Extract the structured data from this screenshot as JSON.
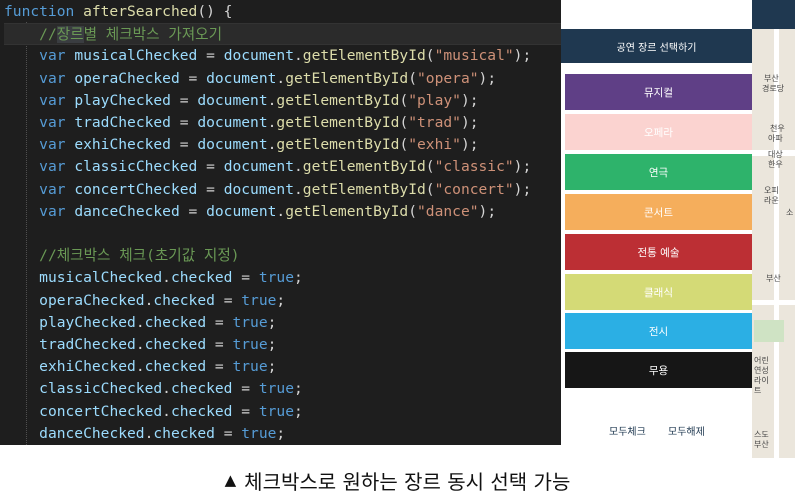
{
  "editor": {
    "lines": [
      [
        {
          "c": "tk-kw",
          "t": "function "
        },
        {
          "c": "tk-fn",
          "t": "afterSearched"
        },
        {
          "c": "tk-pl",
          "t": "() {"
        }
      ],
      [
        {
          "c": "tk-pl",
          "t": "    "
        },
        {
          "c": "tk-cm",
          "t": "//"
        },
        {
          "c": "tk-cm tk-sel",
          "t": "장르"
        },
        {
          "c": "tk-cm",
          "t": "별 체크박스 가져오기"
        }
      ],
      [
        {
          "c": "tk-pl",
          "t": "    "
        },
        {
          "c": "tk-kw",
          "t": "var "
        },
        {
          "c": "tk-var",
          "t": "musicalChecked"
        },
        {
          "c": "tk-pl",
          "t": " = "
        },
        {
          "c": "tk-var",
          "t": "document"
        },
        {
          "c": "tk-pl",
          "t": "."
        },
        {
          "c": "tk-fn",
          "t": "getElementById"
        },
        {
          "c": "tk-pl",
          "t": "("
        },
        {
          "c": "tk-str",
          "t": "\"musical\""
        },
        {
          "c": "tk-pl",
          "t": ");"
        }
      ],
      [
        {
          "c": "tk-pl",
          "t": "    "
        },
        {
          "c": "tk-kw",
          "t": "var "
        },
        {
          "c": "tk-var",
          "t": "operaChecked"
        },
        {
          "c": "tk-pl",
          "t": " = "
        },
        {
          "c": "tk-var",
          "t": "document"
        },
        {
          "c": "tk-pl",
          "t": "."
        },
        {
          "c": "tk-fn",
          "t": "getElementById"
        },
        {
          "c": "tk-pl",
          "t": "("
        },
        {
          "c": "tk-str",
          "t": "\"opera\""
        },
        {
          "c": "tk-pl",
          "t": ");"
        }
      ],
      [
        {
          "c": "tk-pl",
          "t": "    "
        },
        {
          "c": "tk-kw",
          "t": "var "
        },
        {
          "c": "tk-var",
          "t": "playChecked"
        },
        {
          "c": "tk-pl",
          "t": " = "
        },
        {
          "c": "tk-var",
          "t": "document"
        },
        {
          "c": "tk-pl",
          "t": "."
        },
        {
          "c": "tk-fn",
          "t": "getElementById"
        },
        {
          "c": "tk-pl",
          "t": "("
        },
        {
          "c": "tk-str",
          "t": "\"play\""
        },
        {
          "c": "tk-pl",
          "t": ");"
        }
      ],
      [
        {
          "c": "tk-pl",
          "t": "    "
        },
        {
          "c": "tk-kw",
          "t": "var "
        },
        {
          "c": "tk-var",
          "t": "tradChecked"
        },
        {
          "c": "tk-pl",
          "t": " = "
        },
        {
          "c": "tk-var",
          "t": "document"
        },
        {
          "c": "tk-pl",
          "t": "."
        },
        {
          "c": "tk-fn",
          "t": "getElementById"
        },
        {
          "c": "tk-pl",
          "t": "("
        },
        {
          "c": "tk-str",
          "t": "\"trad\""
        },
        {
          "c": "tk-pl",
          "t": ");"
        }
      ],
      [
        {
          "c": "tk-pl",
          "t": "    "
        },
        {
          "c": "tk-kw",
          "t": "var "
        },
        {
          "c": "tk-var",
          "t": "exhiChecked"
        },
        {
          "c": "tk-pl",
          "t": " = "
        },
        {
          "c": "tk-var",
          "t": "document"
        },
        {
          "c": "tk-pl",
          "t": "."
        },
        {
          "c": "tk-fn",
          "t": "getElementById"
        },
        {
          "c": "tk-pl",
          "t": "("
        },
        {
          "c": "tk-str",
          "t": "\"exhi\""
        },
        {
          "c": "tk-pl",
          "t": ");"
        }
      ],
      [
        {
          "c": "tk-pl",
          "t": "    "
        },
        {
          "c": "tk-kw",
          "t": "var "
        },
        {
          "c": "tk-var",
          "t": "classicChecked"
        },
        {
          "c": "tk-pl",
          "t": " = "
        },
        {
          "c": "tk-var",
          "t": "document"
        },
        {
          "c": "tk-pl",
          "t": "."
        },
        {
          "c": "tk-fn",
          "t": "getElementById"
        },
        {
          "c": "tk-pl",
          "t": "("
        },
        {
          "c": "tk-str",
          "t": "\"classic\""
        },
        {
          "c": "tk-pl",
          "t": ");"
        }
      ],
      [
        {
          "c": "tk-pl",
          "t": "    "
        },
        {
          "c": "tk-kw",
          "t": "var "
        },
        {
          "c": "tk-var",
          "t": "concertChecked"
        },
        {
          "c": "tk-pl",
          "t": " = "
        },
        {
          "c": "tk-var",
          "t": "document"
        },
        {
          "c": "tk-pl",
          "t": "."
        },
        {
          "c": "tk-fn",
          "t": "getElementById"
        },
        {
          "c": "tk-pl",
          "t": "("
        },
        {
          "c": "tk-str",
          "t": "\"concert\""
        },
        {
          "c": "tk-pl",
          "t": ");"
        }
      ],
      [
        {
          "c": "tk-pl",
          "t": "    "
        },
        {
          "c": "tk-kw",
          "t": "var "
        },
        {
          "c": "tk-var",
          "t": "danceChecked"
        },
        {
          "c": "tk-pl",
          "t": " = "
        },
        {
          "c": "tk-var",
          "t": "document"
        },
        {
          "c": "tk-pl",
          "t": "."
        },
        {
          "c": "tk-fn",
          "t": "getElementById"
        },
        {
          "c": "tk-pl",
          "t": "("
        },
        {
          "c": "tk-str",
          "t": "\"dance\""
        },
        {
          "c": "tk-pl",
          "t": ");"
        }
      ],
      [],
      [
        {
          "c": "tk-pl",
          "t": "    "
        },
        {
          "c": "tk-cm",
          "t": "//체크박스 체크(초기값 지정)"
        }
      ],
      [
        {
          "c": "tk-pl",
          "t": "    "
        },
        {
          "c": "tk-var",
          "t": "musicalChecked"
        },
        {
          "c": "tk-pl",
          "t": "."
        },
        {
          "c": "tk-var",
          "t": "checked"
        },
        {
          "c": "tk-pl",
          "t": " = "
        },
        {
          "c": "tk-bool",
          "t": "true"
        },
        {
          "c": "tk-pl",
          "t": ";"
        }
      ],
      [
        {
          "c": "tk-pl",
          "t": "    "
        },
        {
          "c": "tk-var",
          "t": "operaChecked"
        },
        {
          "c": "tk-pl",
          "t": "."
        },
        {
          "c": "tk-var",
          "t": "checked"
        },
        {
          "c": "tk-pl",
          "t": " = "
        },
        {
          "c": "tk-bool",
          "t": "true"
        },
        {
          "c": "tk-pl",
          "t": ";"
        }
      ],
      [
        {
          "c": "tk-pl",
          "t": "    "
        },
        {
          "c": "tk-var",
          "t": "playChecked"
        },
        {
          "c": "tk-pl",
          "t": "."
        },
        {
          "c": "tk-var",
          "t": "checked"
        },
        {
          "c": "tk-pl",
          "t": " = "
        },
        {
          "c": "tk-bool",
          "t": "true"
        },
        {
          "c": "tk-pl",
          "t": ";"
        }
      ],
      [
        {
          "c": "tk-pl",
          "t": "    "
        },
        {
          "c": "tk-var",
          "t": "tradChecked"
        },
        {
          "c": "tk-pl",
          "t": "."
        },
        {
          "c": "tk-var",
          "t": "checked"
        },
        {
          "c": "tk-pl",
          "t": " = "
        },
        {
          "c": "tk-bool",
          "t": "true"
        },
        {
          "c": "tk-pl",
          "t": ";"
        }
      ],
      [
        {
          "c": "tk-pl",
          "t": "    "
        },
        {
          "c": "tk-var",
          "t": "exhiChecked"
        },
        {
          "c": "tk-pl",
          "t": "."
        },
        {
          "c": "tk-var",
          "t": "checked"
        },
        {
          "c": "tk-pl",
          "t": " = "
        },
        {
          "c": "tk-bool",
          "t": "true"
        },
        {
          "c": "tk-pl",
          "t": ";"
        }
      ],
      [
        {
          "c": "tk-pl",
          "t": "    "
        },
        {
          "c": "tk-var",
          "t": "classicChecked"
        },
        {
          "c": "tk-pl",
          "t": "."
        },
        {
          "c": "tk-var",
          "t": "checked"
        },
        {
          "c": "tk-pl",
          "t": " = "
        },
        {
          "c": "tk-bool",
          "t": "true"
        },
        {
          "c": "tk-pl",
          "t": ";"
        }
      ],
      [
        {
          "c": "tk-pl",
          "t": "    "
        },
        {
          "c": "tk-var",
          "t": "concertChecked"
        },
        {
          "c": "tk-pl",
          "t": "."
        },
        {
          "c": "tk-var",
          "t": "checked"
        },
        {
          "c": "tk-pl",
          "t": " = "
        },
        {
          "c": "tk-bool",
          "t": "true"
        },
        {
          "c": "tk-pl",
          "t": ";"
        }
      ],
      [
        {
          "c": "tk-pl",
          "t": "    "
        },
        {
          "c": "tk-var",
          "t": "danceChecked"
        },
        {
          "c": "tk-pl",
          "t": "."
        },
        {
          "c": "tk-var",
          "t": "checked"
        },
        {
          "c": "tk-pl",
          "t": " = "
        },
        {
          "c": "tk-bool",
          "t": "true"
        },
        {
          "c": "tk-pl",
          "t": ";"
        }
      ]
    ]
  },
  "panel": {
    "header": "공연 장르 선택하기",
    "genres": [
      {
        "label": "뮤지컬",
        "color": "#5f3f86"
      },
      {
        "label": "오페라",
        "color": "#fbd3d0"
      },
      {
        "label": "연극",
        "color": "#2eb36b"
      },
      {
        "label": "콘서트",
        "color": "#f5ae5c"
      },
      {
        "label": "전통 예술",
        "color": "#bc2f34"
      },
      {
        "label": "클래식",
        "color": "#d4da76"
      },
      {
        "label": "전시",
        "color": "#2bafe4"
      },
      {
        "label": "무용",
        "color": "#161616"
      }
    ],
    "check_all": "모두체크",
    "uncheck_all": "모두해제"
  },
  "map": {
    "labels": [
      "부산",
      "경로당",
      "천우",
      "아파",
      "대상",
      "한우",
      "오피",
      "라운",
      "소",
      "부산",
      "어린",
      "연성",
      "라이",
      "트",
      "스도",
      "부산"
    ]
  },
  "caption": {
    "icon": "triangle-up-icon",
    "text": "체크박스로 원하는 장르 동시 선택 가능"
  }
}
